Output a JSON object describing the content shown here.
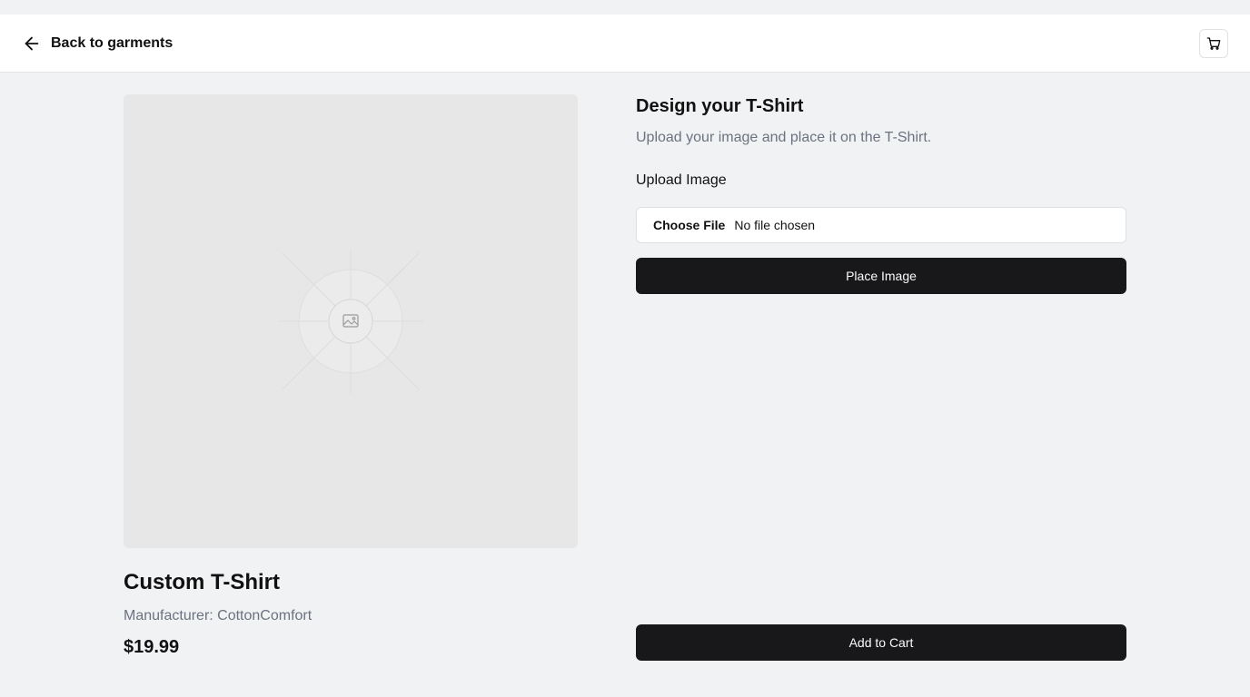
{
  "header": {
    "back_label": "Back to garments",
    "back_icon": "arrow-left-icon",
    "cart_icon": "shopping-cart-icon"
  },
  "product": {
    "name": "Custom T-Shirt",
    "manufacturer_prefix": "Manufacturer: ",
    "manufacturer": "CottonComfort",
    "price": "$19.99",
    "preview_icon": "image-placeholder-icon"
  },
  "design": {
    "title": "Design your T-Shirt",
    "subtitle": "Upload your image and place it on the T-Shirt.",
    "upload_label": "Upload Image",
    "file_button": "Choose File",
    "file_status": "No file chosen",
    "place_button": "Place Image",
    "add_to_cart": "Add to Cart"
  },
  "colors": {
    "page_bg": "#f1f2f4",
    "button_bg": "#18181b",
    "preview_bg": "#e7e7e8",
    "muted_text": "#6b7280"
  }
}
